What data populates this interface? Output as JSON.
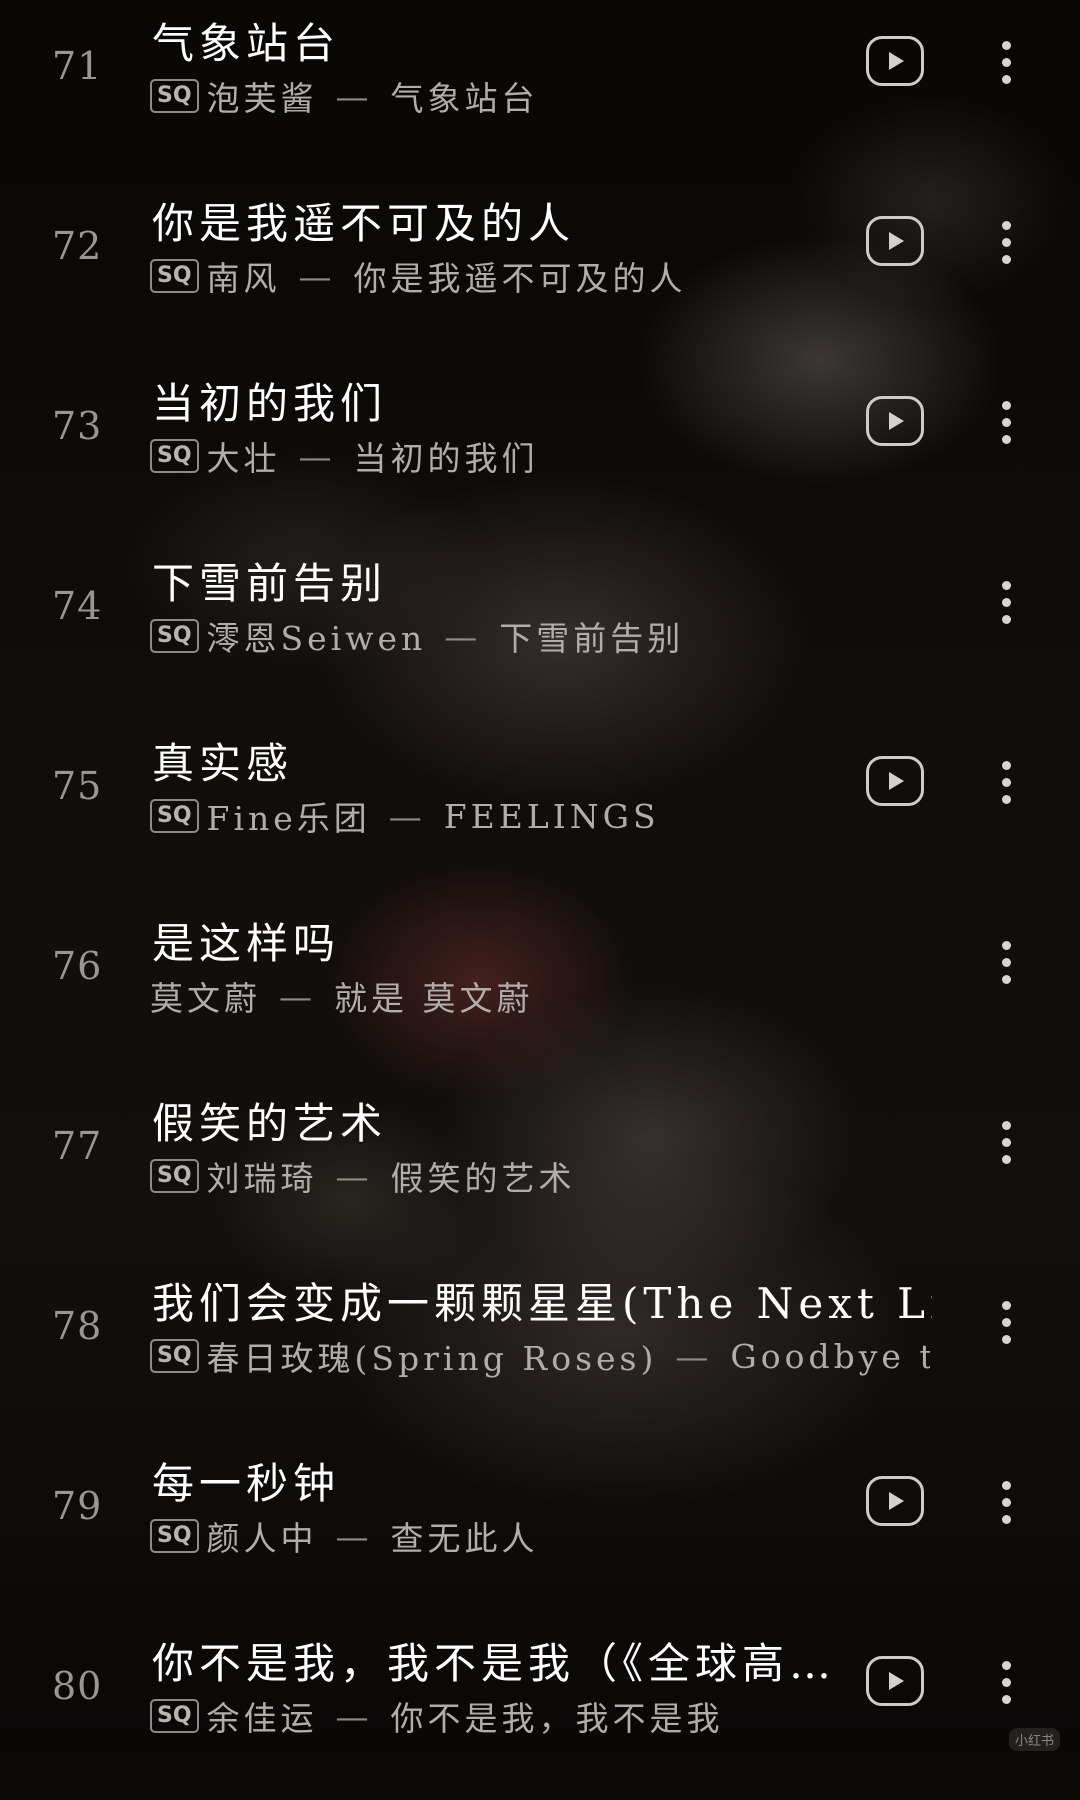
{
  "songs": [
    {
      "num": "71",
      "title": "气象站台",
      "sq": "SQ",
      "artist": "泡芙酱",
      "dash": "—",
      "album": "气象站台",
      "has_play": true
    },
    {
      "num": "72",
      "title": "你是我遥不可及的人",
      "sq": "SQ",
      "artist": "南风",
      "dash": "—",
      "album": "你是我遥不可及的人",
      "has_play": true
    },
    {
      "num": "73",
      "title": "当初的我们",
      "sq": "SQ",
      "artist": "大壮",
      "dash": "—",
      "album": "当初的我们",
      "has_play": true
    },
    {
      "num": "74",
      "title": "下雪前告别",
      "sq": "SQ",
      "artist": "澪恩Seiwen",
      "dash": "—",
      "album": "下雪前告别",
      "has_play": false
    },
    {
      "num": "75",
      "title": "真实感",
      "sq": "SQ",
      "artist": "Fine乐团",
      "dash": "—",
      "album": "FEELINGS",
      "has_play": true
    },
    {
      "num": "76",
      "title": "是这样吗",
      "sq": "",
      "artist": "莫文蔚",
      "dash": "—",
      "album": "就是 莫文蔚",
      "has_play": false
    },
    {
      "num": "77",
      "title": "假笑的艺术",
      "sq": "SQ",
      "artist": "刘瑞琦",
      "dash": "—",
      "album": "假笑的艺术",
      "has_play": false
    },
    {
      "num": "78",
      "title": "我们会变成一颗颗星星(The Next Life)",
      "sq": "SQ",
      "artist": "春日玫瑰(Spring Roses)",
      "dash": "—",
      "album": "Goodbye to Weihai",
      "has_play": false
    },
    {
      "num": "79",
      "title": "每一秒钟",
      "sq": "SQ",
      "artist": "颜人中",
      "dash": "—",
      "album": "查无此人",
      "has_play": true
    },
    {
      "num": "80",
      "title": "你不是我，我不是我（《全球高…",
      "sq": "SQ",
      "artist": "余佳运",
      "dash": "—",
      "album": "你不是我，我不是我",
      "has_play": true
    }
  ],
  "icons": {
    "play": "play-icon",
    "more": "more-vertical-icon"
  },
  "watermark": "小红书"
}
